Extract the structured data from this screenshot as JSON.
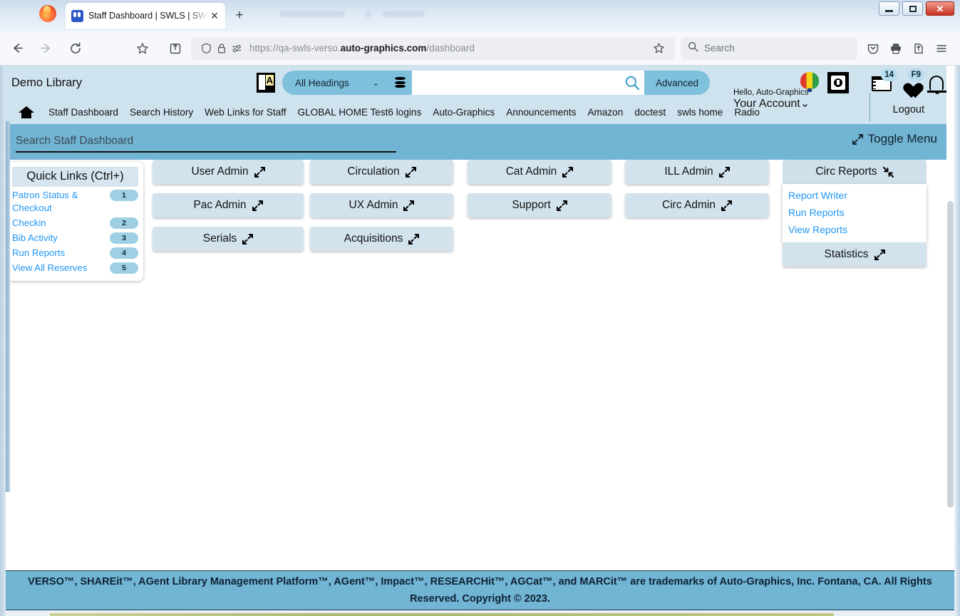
{
  "browser": {
    "tab_title": "Staff Dashboard | SWLS | SWLS",
    "tab_close_glyph": "✕",
    "newtab_glyph": "+",
    "url_scheme": "https://",
    "url_sub": "qa-swls-verso.",
    "url_domain": "auto-graphics.com",
    "url_path": "/dashboard",
    "toolbar_search_placeholder": "Search",
    "window_controls": {
      "minimize": "–",
      "maximize": "□",
      "close": "✕"
    }
  },
  "header": {
    "library_name": "Demo Library",
    "headings_select": "All Headings",
    "headings_caret": "⌄",
    "search_value": "",
    "search_placeholder": "",
    "advanced_label": "Advanced",
    "account_hello": "Hello, Auto-Graphics",
    "account_label": "Your Account",
    "account_caret": "⌄",
    "logout_label": "Logout",
    "calendar_badge": "14",
    "heart_badge": "F9"
  },
  "nav_links": [
    "Staff Dashboard",
    "Search History",
    "Web Links for Staff",
    "GLOBAL HOME Test6 logins",
    "Auto-Graphics",
    "Announcements",
    "Amazon",
    "doctest",
    "swls home",
    "Radio"
  ],
  "dashboard_search": {
    "value": "",
    "placeholder": "Search Staff Dashboard"
  },
  "toggle_menu_label": "Toggle Menu",
  "quick_links": {
    "title": "Quick Links (Ctrl+)",
    "items": [
      {
        "label": "Patron Status & Checkout",
        "key": "1"
      },
      {
        "label": "Checkin",
        "key": "2"
      },
      {
        "label": "Bib Activity",
        "key": "3"
      },
      {
        "label": "Run Reports",
        "key": "4"
      },
      {
        "label": "View All Reserves",
        "key": "5"
      }
    ]
  },
  "tiles": {
    "user_admin": "User Admin",
    "pac_admin": "Pac Admin",
    "serials": "Serials",
    "circulation": "Circulation",
    "ux_admin": "UX Admin",
    "acquisitions": "Acquisitions",
    "cat_admin": "Cat Admin",
    "support": "Support",
    "ill_admin": "ILL Admin",
    "circ_admin": "Circ Admin",
    "circ_reports": "Circ Reports",
    "statistics": "Statistics"
  },
  "circ_reports_menu": [
    "Report Writer",
    "Run Reports",
    "View Reports"
  ],
  "footer": {
    "line1": "VERSO™, SHAREit™, AGent Library Management Platform™, AGent™, Impact™, RESEARCHit™, AGCat™, and MARCit™ are trademarks of Auto-Graphics, Inc.  Fontana, CA.  All Rights Reserved. Copyright © 2023."
  },
  "colors": {
    "header_bg": "#cfe3ef",
    "strip_blue": "#72b4d4",
    "accent_blue": "#7fc0dd",
    "tile_bg": "#d3e3ee",
    "link_blue": "#2196f3",
    "badge_bg": "#9ecfe3"
  }
}
